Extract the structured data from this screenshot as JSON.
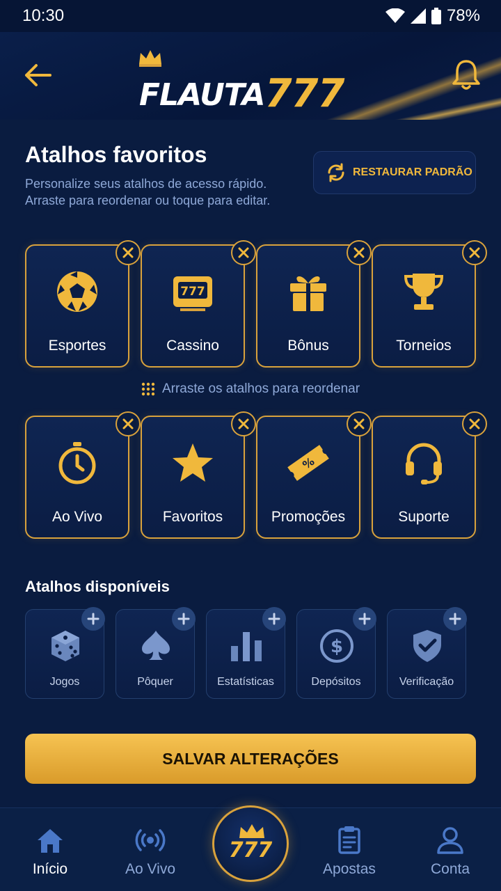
{
  "status_bar": {
    "time": "10:30",
    "battery": "78%"
  },
  "header": {
    "logo_white": "FLAUTA",
    "logo_gold": "777"
  },
  "main": {
    "title": "Atalhos favoritos",
    "subtitle_line1": "Personalize seus atalhos de acesso rápido.",
    "subtitle_line2": "Arraste para reordenar ou toque para editar.",
    "restore_label": "RESTAURAR PADRÃO",
    "favorites": [
      {
        "label": "Esportes",
        "icon": "soccer-ball-icon"
      },
      {
        "label": "Cassino",
        "icon": "slot-machine-icon"
      },
      {
        "label": "Bônus",
        "icon": "gift-icon"
      },
      {
        "label": "Torneios",
        "icon": "trophy-icon"
      },
      {
        "label": "Ao Vivo",
        "icon": "stopwatch-icon"
      },
      {
        "label": "Favoritos",
        "icon": "star-icon"
      },
      {
        "label": "Promoções",
        "icon": "ticket-icon"
      },
      {
        "label": "Suporte",
        "icon": "headset-icon"
      }
    ],
    "hint": "Arraste os atalhos para reordenar",
    "available_title": "Atalhos disponíveis",
    "available": [
      {
        "label": "Jogos",
        "icon": "dice-icon"
      },
      {
        "label": "Pôquer",
        "icon": "spade-icon"
      },
      {
        "label": "Estatísticas",
        "icon": "bar-chart-icon"
      },
      {
        "label": "Depósitos",
        "icon": "dollar-icon"
      },
      {
        "label": "Verificação",
        "icon": "shield-check-icon"
      }
    ],
    "save_label": "SALVAR ALTERAÇÕES"
  },
  "bottom_nav": {
    "items": [
      {
        "label": "Início",
        "icon": "home-icon"
      },
      {
        "label": "Ao Vivo",
        "icon": "broadcast-icon"
      },
      {
        "label": "777",
        "icon": "crown-icon"
      },
      {
        "label": "Apostas",
        "icon": "clipboard-icon"
      },
      {
        "label": "Conta",
        "icon": "user-icon"
      }
    ]
  },
  "colors": {
    "gold": "#f0b83c",
    "background": "#0a1c40",
    "muted_text": "#8fa9d8"
  }
}
